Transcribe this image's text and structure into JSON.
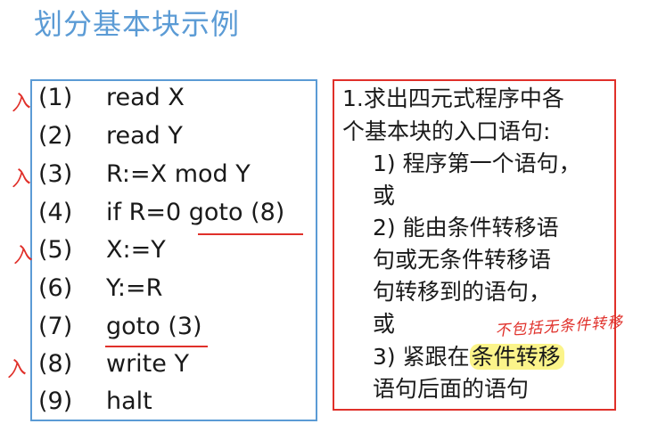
{
  "title": "划分基本块示例",
  "code": [
    {
      "num": "(1)",
      "text": "read X"
    },
    {
      "num": "(2)",
      "text": "read Y"
    },
    {
      "num": "(3)",
      "text": "R:=X mod Y"
    },
    {
      "num": "(4)",
      "text": "if  R=0 goto (8)"
    },
    {
      "num": "(5)",
      "text": "X:=Y"
    },
    {
      "num": "(6)",
      "text": "Y:=R"
    },
    {
      "num": "(7)",
      "text": "goto (3)"
    },
    {
      "num": "(8)",
      "text": "write Y"
    },
    {
      "num": "(9)",
      "text": "halt"
    }
  ],
  "entry_mark": "入",
  "rules": {
    "line1": "1.求出四元式程序中各",
    "line2": "个基本块的入口语句:",
    "r1": "1) 程序第一个语句，",
    "or1": "或",
    "r2a": "2) 能由条件转移语",
    "r2b": "句或无条件转移语",
    "r2c": "句转移到的语句，",
    "or2": "或",
    "r3_prefix": "3) 紧跟在",
    "r3_highlight": "条件转移",
    "r3b": "语句后面的语句"
  },
  "handwritten_note": "不包括无条件转移",
  "colors": {
    "title": "#5b9bd5",
    "left_border": "#5b9bd5",
    "right_border": "#e0302a",
    "annotation": "#e0302a",
    "highlight": "#fbf48a"
  }
}
